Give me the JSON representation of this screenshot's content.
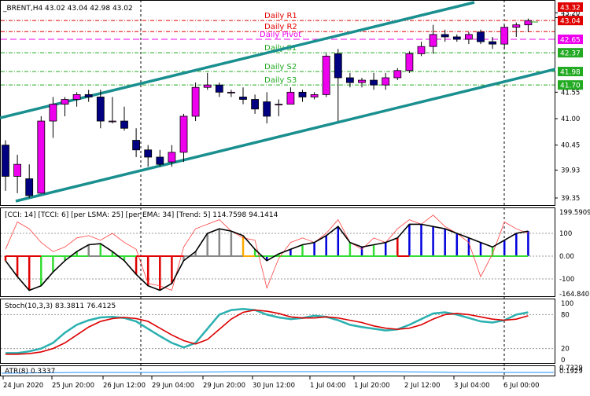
{
  "colors": {
    "bull": "#ee00ee",
    "bear": "#000080",
    "channel": "#1a8f8f",
    "r_line": "#e00000",
    "pivot_line": "#ee00ee",
    "s_line": "#22aa22",
    "cci_thin": "#ff4040",
    "stoch_main": "#2bb0b0",
    "stoch_signal": "#dd0000",
    "atr": "#1e90ff"
  },
  "main": {
    "title": "_BRENT,H4  43.02 43.04 42.98 43.02",
    "levels": [
      {
        "label": "Daily R2",
        "price": 42.81,
        "kind": "r"
      },
      {
        "label": "Daily R1",
        "price": 43.04,
        "kind": "r"
      },
      {
        "label": "Daily Pivot",
        "price": 42.65,
        "kind": "pivot"
      },
      {
        "label": "Daily S1",
        "price": 42.37,
        "kind": "s"
      },
      {
        "label": "Daily S2",
        "price": 41.98,
        "kind": "s"
      },
      {
        "label": "Daily S3",
        "price": 41.7,
        "kind": "s"
      }
    ],
    "price_ticks": [
      "43.20",
      "43.10",
      "41.55",
      "41.00",
      "40.45",
      "39.93",
      "39.35"
    ],
    "price_labels": [
      {
        "text": "43.32",
        "color": "#e00000"
      },
      {
        "text": "43.04",
        "color": "#e00000"
      },
      {
        "text": "42.65",
        "color": "#ee00ee"
      },
      {
        "text": "42.37",
        "color": "#22aa22"
      },
      {
        "text": "41.98",
        "color": "#22aa22"
      },
      {
        "text": "41.70",
        "color": "#22aa22"
      }
    ],
    "price_label_values": [
      43.32,
      43.04,
      42.65,
      42.37,
      41.98,
      41.7
    ],
    "price_tick_values": [
      43.2,
      43.1,
      41.55,
      41.0,
      40.45,
      39.93,
      39.35
    ]
  },
  "cci": {
    "title": "[CCI: 14] [TCCI: 6] [per LSMA: 25] [per EMA: 34] [Trend: 5]  114.7598 94.1414",
    "ticks": [
      "199.5909",
      "100",
      "0.00",
      "-100",
      "-164.840"
    ],
    "tick_values": [
      199.59,
      100,
      0,
      -100,
      -164.84
    ]
  },
  "stoch": {
    "title": "Stoch(10,3,3) 83.3811 76.4125",
    "ticks": [
      "100",
      "80",
      "20",
      "0"
    ],
    "tick_values": [
      100,
      80,
      20,
      0
    ]
  },
  "atr": {
    "title": "ATR(8) 0.3337",
    "ticks": [
      "0.7329",
      "0.1929"
    ],
    "tick_values": [
      0.7329,
      0.1929
    ]
  },
  "time_axis": [
    "24 Jun 2020",
    "25 Jun 20:00",
    "26 Jun 12:00",
    "29 Jun 04:00",
    "29 Jun 20:00",
    "30 Jun 12:00",
    "1 Jul 04:00",
    "1 Jul 20:00",
    "2 Jul 12:00",
    "3 Jul 04:00",
    "6 Jul 00:00"
  ],
  "chart_data": {
    "type": "candlestick",
    "candles": [
      [
        40.45,
        40.55,
        39.5,
        39.8
      ],
      [
        39.8,
        40.25,
        39.45,
        40.05
      ],
      [
        39.75,
        40.05,
        39.35,
        39.4
      ],
      [
        39.45,
        41.05,
        39.45,
        40.95
      ],
      [
        40.95,
        41.45,
        40.6,
        41.3
      ],
      [
        41.3,
        41.45,
        41.05,
        41.4
      ],
      [
        41.4,
        41.55,
        41.25,
        41.5
      ],
      [
        41.5,
        41.6,
        41.35,
        41.45
      ],
      [
        41.45,
        41.6,
        40.8,
        40.95
      ],
      [
        40.95,
        41.45,
        40.9,
        40.95
      ],
      [
        40.95,
        41.25,
        40.75,
        40.8
      ],
      [
        40.55,
        40.8,
        40.2,
        40.35
      ],
      [
        40.35,
        40.45,
        40.0,
        40.2
      ],
      [
        40.2,
        40.35,
        40.0,
        40.05
      ],
      [
        40.1,
        40.45,
        40.0,
        40.3
      ],
      [
        40.3,
        41.1,
        40.1,
        41.05
      ],
      [
        41.05,
        41.75,
        40.95,
        41.65
      ],
      [
        41.65,
        41.95,
        41.6,
        41.7
      ],
      [
        41.7,
        41.75,
        41.45,
        41.55
      ],
      [
        41.55,
        41.6,
        41.45,
        41.55
      ],
      [
        41.45,
        41.65,
        41.3,
        41.4
      ],
      [
        41.4,
        41.5,
        41.1,
        41.2
      ],
      [
        41.35,
        41.55,
        40.9,
        41.05
      ],
      [
        41.3,
        41.4,
        41.05,
        41.3
      ],
      [
        41.3,
        41.65,
        41.3,
        41.55
      ],
      [
        41.55,
        41.6,
        41.35,
        41.45
      ],
      [
        41.45,
        41.55,
        41.4,
        41.5
      ],
      [
        41.5,
        42.35,
        41.45,
        42.3
      ],
      [
        42.35,
        42.45,
        40.95,
        41.85
      ],
      [
        41.85,
        41.95,
        41.65,
        41.75
      ],
      [
        41.75,
        41.85,
        41.65,
        41.8
      ],
      [
        41.8,
        41.95,
        41.6,
        41.7
      ],
      [
        41.7,
        41.95,
        41.6,
        41.85
      ],
      [
        41.85,
        42.05,
        41.8,
        42.0
      ],
      [
        42.0,
        42.4,
        41.95,
        42.35
      ],
      [
        42.35,
        42.6,
        42.3,
        42.5
      ],
      [
        42.5,
        42.95,
        42.35,
        42.75
      ],
      [
        42.75,
        42.85,
        42.6,
        42.7
      ],
      [
        42.7,
        42.75,
        42.6,
        42.65
      ],
      [
        42.65,
        42.8,
        42.55,
        42.75
      ],
      [
        42.8,
        42.85,
        42.55,
        42.6
      ],
      [
        42.6,
        42.7,
        42.45,
        42.55
      ],
      [
        42.55,
        42.95,
        42.45,
        42.9
      ],
      [
        42.9,
        43.0,
        42.7,
        42.95
      ],
      [
        42.95,
        43.08,
        42.8,
        43.04
      ]
    ],
    "stoch_main": [
      12,
      12,
      15,
      20,
      30,
      48,
      62,
      70,
      75,
      76,
      74,
      68,
      55,
      42,
      30,
      22,
      30,
      55,
      80,
      88,
      90,
      88,
      80,
      75,
      72,
      74,
      78,
      76,
      70,
      62,
      58,
      55,
      52,
      54,
      62,
      72,
      82,
      84,
      80,
      74,
      68,
      66,
      70,
      80,
      84
    ],
    "stoch_signal": [
      10,
      10,
      11,
      14,
      20,
      30,
      44,
      58,
      68,
      73,
      75,
      73,
      68,
      56,
      44,
      34,
      28,
      36,
      54,
      72,
      84,
      88,
      86,
      82,
      76,
      74,
      74,
      76,
      74,
      70,
      66,
      60,
      56,
      54,
      56,
      62,
      72,
      80,
      82,
      80,
      76,
      72,
      70,
      72,
      78
    ],
    "cci_line": [
      -20,
      -90,
      -150,
      -130,
      -70,
      -20,
      20,
      50,
      55,
      20,
      -20,
      -80,
      -130,
      -150,
      -120,
      -20,
      20,
      100,
      120,
      110,
      90,
      30,
      -20,
      10,
      30,
      50,
      60,
      90,
      130,
      60,
      40,
      50,
      60,
      80,
      140,
      140,
      130,
      120,
      100,
      80,
      60,
      40,
      70,
      100,
      110
    ],
    "cci_thin": [
      30,
      150,
      120,
      60,
      20,
      40,
      80,
      90,
      70,
      100,
      60,
      30,
      -120,
      -130,
      -150,
      40,
      120,
      140,
      160,
      110,
      80,
      70,
      -140,
      -10,
      60,
      80,
      60,
      100,
      160,
      60,
      30,
      80,
      60,
      120,
      160,
      140,
      180,
      130,
      100,
      60,
      -90,
      10,
      150,
      120,
      100
    ],
    "cci_hist_colors": [
      "red",
      "red",
      "red",
      "green",
      "green",
      "green",
      "green",
      "gray",
      "green",
      "green",
      "green",
      "red",
      "red",
      "red",
      "red",
      "gray",
      "gray",
      "gray",
      "gray",
      "gray",
      "orange",
      "green",
      "blue",
      "green",
      "blue",
      "green",
      "blue",
      "blue",
      "blue",
      "green",
      "blue",
      "green",
      "blue",
      "red",
      "blue",
      "blue",
      "blue",
      "blue",
      "blue",
      "blue",
      "blue",
      "green",
      "blue",
      "blue",
      "blue"
    ]
  }
}
